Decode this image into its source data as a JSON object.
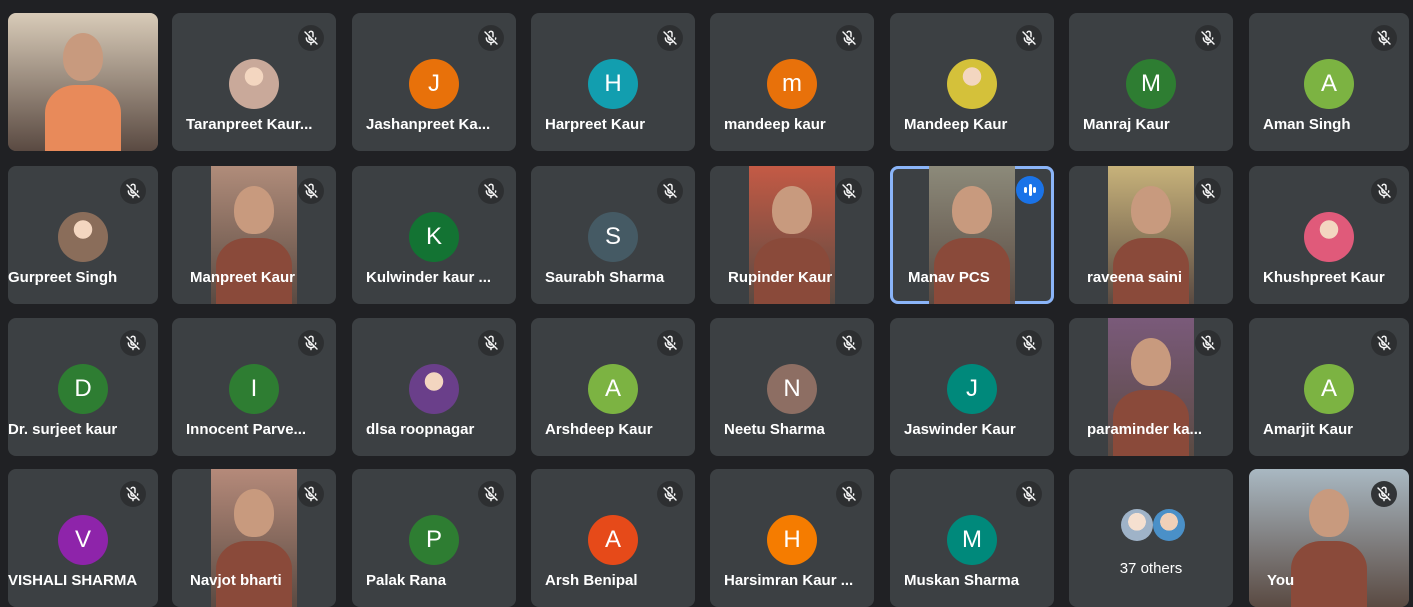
{
  "meeting": {
    "participants": [
      {
        "name": "",
        "type": "video",
        "video_bg": "#d8cbb8",
        "muted": false
      },
      {
        "name": "Taranpreet Kaur...",
        "type": "photo",
        "photo_bg": "#c9a99a",
        "muted": true
      },
      {
        "name": "Jashanpreet Ka...",
        "type": "initial",
        "initial": "J",
        "color": "#e8710a",
        "muted": true
      },
      {
        "name": "Harpreet Kaur",
        "type": "initial",
        "initial": "H",
        "color": "#129eaf",
        "muted": true
      },
      {
        "name": "mandeep kaur",
        "type": "initial",
        "initial": "m",
        "color": "#e8710a",
        "muted": true
      },
      {
        "name": "Mandeep Kaur",
        "type": "photo",
        "photo_bg": "#d4c13a",
        "muted": true
      },
      {
        "name": "Manraj Kaur",
        "type": "initial",
        "initial": "M",
        "color": "#2e7d32",
        "muted": true
      },
      {
        "name": "Aman Singh",
        "type": "initial",
        "initial": "A",
        "color": "#7cb342",
        "muted": true
      },
      {
        "name": "Gurpreet Singh",
        "type": "photo",
        "photo_bg": "#8a6d5a",
        "muted": true
      },
      {
        "name": "Manpreet Kaur",
        "type": "video",
        "video_bg": "#b08c7a",
        "muted": true
      },
      {
        "name": "Kulwinder kaur ...",
        "type": "initial",
        "initial": "K",
        "color": "#137333",
        "muted": true
      },
      {
        "name": "Saurabh Sharma",
        "type": "initial",
        "initial": "S",
        "color": "#455a64",
        "muted": true
      },
      {
        "name": "Rupinder Kaur",
        "type": "video",
        "video_bg": "#c45a45",
        "muted": true
      },
      {
        "name": "Manav PCS",
        "type": "video",
        "video_bg": "#8c8a7a",
        "muted": false,
        "speaking": true
      },
      {
        "name": "raveena saini",
        "type": "video",
        "video_bg": "#c7b27a",
        "muted": true
      },
      {
        "name": "Khushpreet Kaur",
        "type": "photo",
        "photo_bg": "#e05a7a",
        "muted": true
      },
      {
        "name": "Dr. surjeet kaur",
        "type": "initial",
        "initial": "D",
        "color": "#2e7d32",
        "muted": true
      },
      {
        "name": "Innocent Parve...",
        "type": "initial",
        "initial": "I",
        "color": "#2e7d32",
        "muted": true
      },
      {
        "name": "dlsa roopnagar",
        "type": "photo",
        "photo_bg": "#6a3f8a",
        "muted": true
      },
      {
        "name": "Arshdeep Kaur",
        "type": "initial",
        "initial": "A",
        "color": "#7cb342",
        "muted": true
      },
      {
        "name": "Neetu Sharma",
        "type": "initial",
        "initial": "N",
        "color": "#8d6e63",
        "muted": true
      },
      {
        "name": "Jaswinder Kaur",
        "type": "initial",
        "initial": "J",
        "color": "#00897b",
        "muted": true
      },
      {
        "name": "paraminder ka...",
        "type": "video",
        "video_bg": "#7a5a7a",
        "muted": true
      },
      {
        "name": "Amarjit Kaur",
        "type": "initial",
        "initial": "A",
        "color": "#7cb342",
        "muted": true
      },
      {
        "name": "VISHALI SHARMA",
        "type": "initial",
        "initial": "V",
        "color": "#8e24aa",
        "muted": true
      },
      {
        "name": "Navjot bharti",
        "type": "video",
        "video_bg": "#b58a7a",
        "muted": true
      },
      {
        "name": "Palak Rana",
        "type": "initial",
        "initial": "P",
        "color": "#2e7d32",
        "muted": true
      },
      {
        "name": "Arsh Benipal",
        "type": "initial",
        "initial": "A",
        "color": "#e64a19",
        "muted": true
      },
      {
        "name": "Harsimran Kaur ...",
        "type": "initial",
        "initial": "H",
        "color": "#f57c00",
        "muted": true
      },
      {
        "name": "Muskan Sharma",
        "type": "initial",
        "initial": "M",
        "color": "#00897b",
        "muted": true
      },
      {
        "name": "37 others",
        "type": "others",
        "muted": false
      },
      {
        "name": "You",
        "type": "video",
        "video_bg": "#a9b8c2",
        "muted": true
      }
    ]
  },
  "icons": {
    "mute": "mic-off-icon",
    "speaking": "audio-level-icon"
  }
}
